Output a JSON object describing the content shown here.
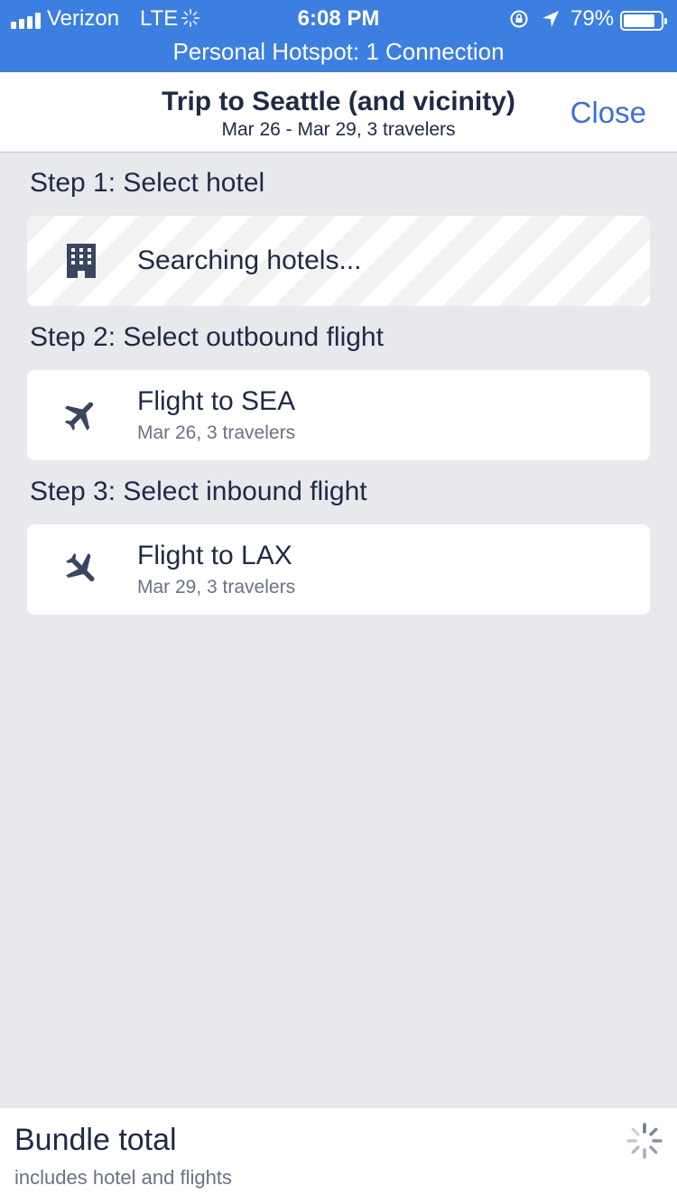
{
  "status_bar": {
    "carrier": "Verizon",
    "network": "LTE",
    "time": "6:08 PM",
    "battery": "79%",
    "battery_level": 0.79,
    "hotspot": "Personal Hotspot: 1 Connection"
  },
  "header": {
    "title": "Trip to Seattle (and vicinity)",
    "subtitle": "Mar 26 - Mar 29, 3 travelers",
    "close_label": "Close"
  },
  "steps": [
    {
      "label": "Step 1: Select hotel",
      "icon": "hotel-building-icon",
      "title": "Searching hotels..."
    },
    {
      "label": "Step 2: Select outbound flight",
      "icon": "airplane-icon",
      "title": "Flight to SEA",
      "subtitle": "Mar 26, 3 travelers"
    },
    {
      "label": "Step 3: Select inbound flight",
      "icon": "airplane-icon",
      "title": "Flight to LAX",
      "subtitle": "Mar 29, 3 travelers"
    }
  ],
  "footer": {
    "title": "Bundle total",
    "subtitle": "includes hotel and flights",
    "icon": "loading-spinner-icon"
  },
  "colors": {
    "status_bar": "#3d7fe0",
    "accent": "#3d6fd6",
    "text": "#1f2a44",
    "secondary_text": "#6a7182",
    "background": "#e8e9ed"
  }
}
